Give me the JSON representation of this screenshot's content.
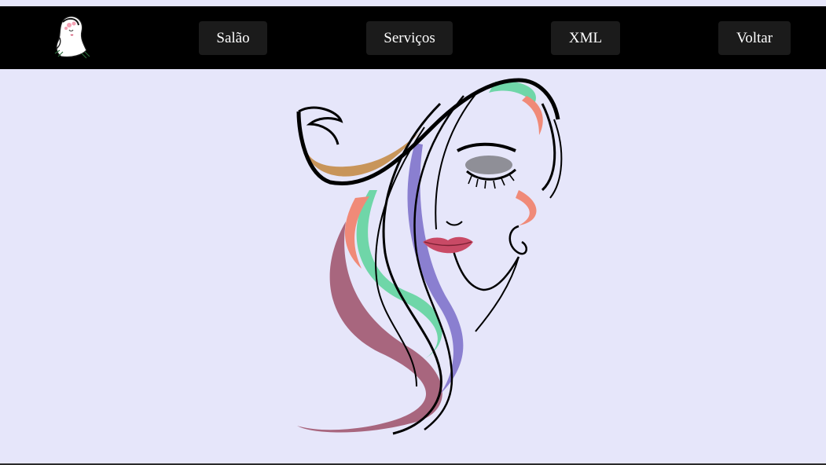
{
  "navbar": {
    "logo_icon": "woman-silhouette-logo-icon",
    "items": [
      {
        "label": "Salão"
      },
      {
        "label": "Serviços"
      },
      {
        "label": "XML"
      },
      {
        "label": "Voltar"
      }
    ]
  },
  "hero": {
    "illustration": "woman-face-line-art-icon"
  },
  "colors": {
    "page_background": "#e6e6fa",
    "navbar_background": "#000000",
    "button_background": "#1b1b1b",
    "button_text": "#ffffff",
    "accent_mint": "#6fd6a8",
    "accent_coral": "#f08a78",
    "accent_mauve": "#a8667e",
    "accent_purple": "#8a7fd0",
    "accent_tan": "#c8955a"
  }
}
